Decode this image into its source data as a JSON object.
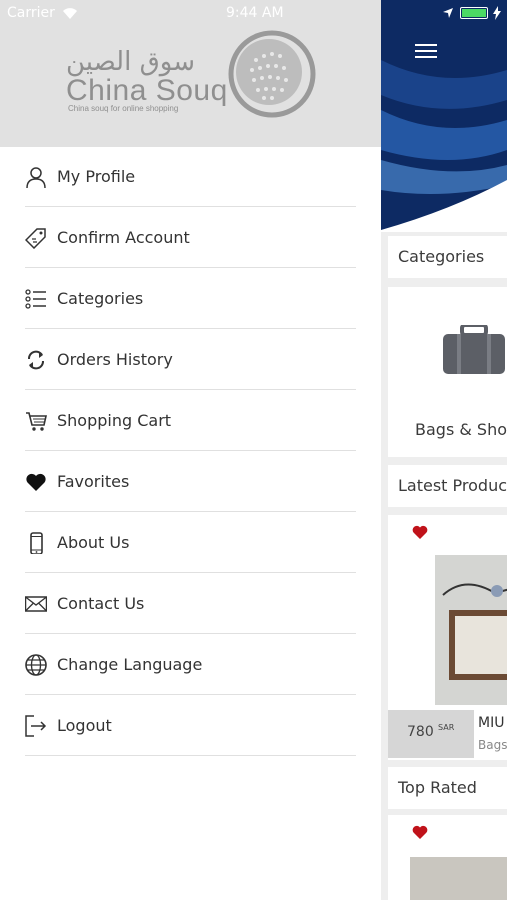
{
  "status_bar": {
    "carrier": "Carrier",
    "time": "9:44 AM"
  },
  "logo": {
    "arabic": "سوق الصين",
    "english": "China Souq",
    "tagline": "China souq for online shopping"
  },
  "drawer_menu": [
    {
      "label": "My Profile",
      "icon": "user-icon"
    },
    {
      "label": "Confirm Account",
      "icon": "tag-icon"
    },
    {
      "label": "Categories",
      "icon": "list-icon"
    },
    {
      "label": "Orders History",
      "icon": "refresh-icon"
    },
    {
      "label": "Shopping Cart",
      "icon": "cart-icon"
    },
    {
      "label": "Favorites",
      "icon": "heart-icon"
    },
    {
      "label": "About Us",
      "icon": "phone-icon"
    },
    {
      "label": "Contact Us",
      "icon": "envelope-icon"
    },
    {
      "label": "Change Language",
      "icon": "globe-icon"
    },
    {
      "label": "Logout",
      "icon": "logout-icon"
    }
  ],
  "main": {
    "categories_title": "Categories",
    "category_label": "Bags & Shoes",
    "latest_title": "Latest Products",
    "product": {
      "price": "780",
      "currency": "SAR",
      "name": "MIU",
      "category": "Bags"
    },
    "top_rated_title": "Top Rated"
  },
  "colors": {
    "banner": "#0d2a63",
    "favorite": "#c0121a",
    "price_bg": "#d6d6d6",
    "drawer_header": "#e1e1e1"
  }
}
